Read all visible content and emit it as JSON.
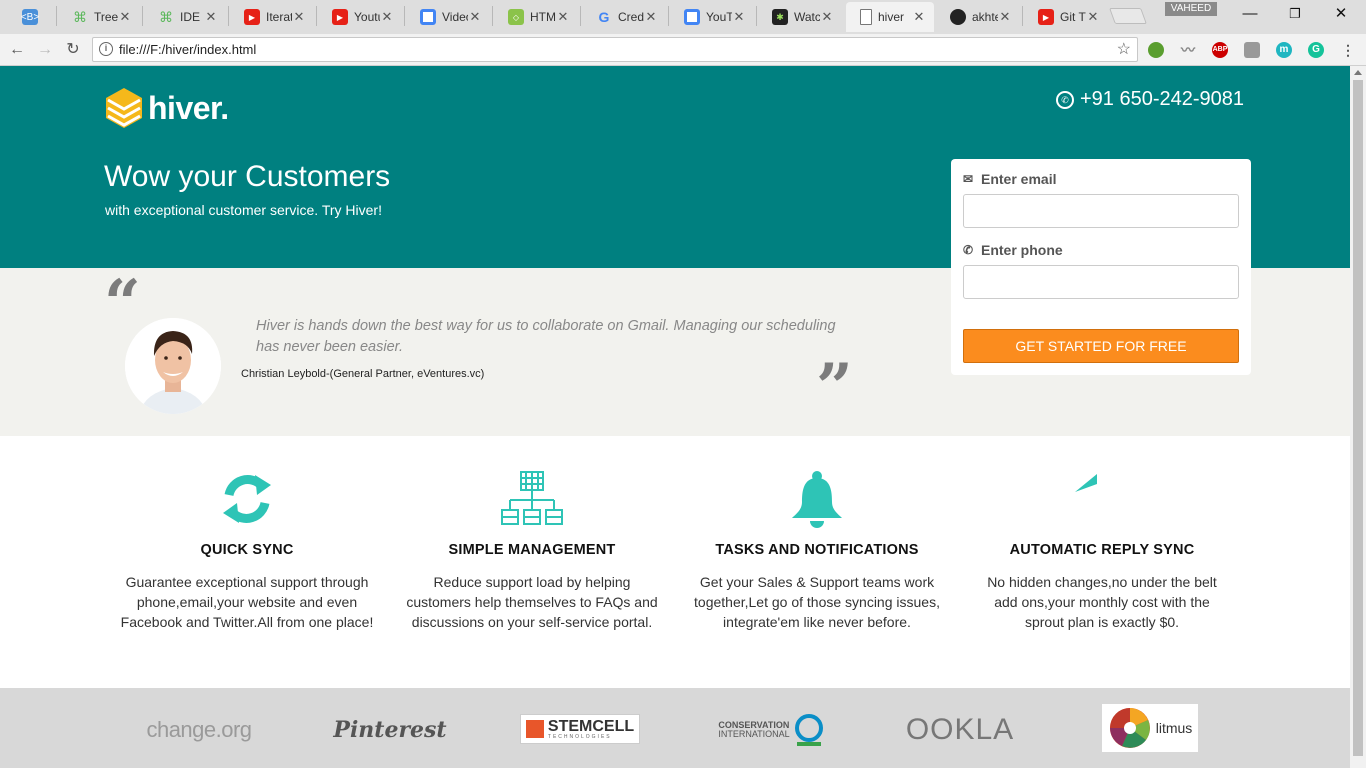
{
  "browser": {
    "tabs": [
      {
        "title": "",
        "fav": "bootstrap-icon",
        "color": "#4a90d9"
      },
      {
        "title": "Tree",
        "fav": "treehouse-icon",
        "color": "#5cb85c"
      },
      {
        "title": "IDE |",
        "fav": "treehouse-icon",
        "color": "#5cb85c"
      },
      {
        "title": "Iterat",
        "fav": "youtube-icon",
        "color": "#e62117"
      },
      {
        "title": "Youtu",
        "fav": "youtube-icon",
        "color": "#e62117"
      },
      {
        "title": "Video",
        "fav": "chrome-icon",
        "color": "#4285f4"
      },
      {
        "title": "HTM",
        "fav": "html-icon",
        "color": "#8bc34a"
      },
      {
        "title": "Cred",
        "fav": "google-icon",
        "color": "#4285f4"
      },
      {
        "title": "YouT",
        "fav": "chrome-icon",
        "color": "#4285f4"
      },
      {
        "title": "Watc",
        "fav": "watch-icon",
        "color": "#333333"
      },
      {
        "title": "hiver",
        "fav": "file-icon",
        "color": "#ffffff"
      },
      {
        "title": "akhte",
        "fav": "github-icon",
        "color": "#222222"
      },
      {
        "title": "Git T",
        "fav": "youtube-icon",
        "color": "#e62117"
      }
    ],
    "profile_name": "VAHEED",
    "url": "file:///F:/hiver/index.html"
  },
  "header": {
    "logo_text": "hiver.",
    "phone": "+91 650-242-9081",
    "title": "Wow your Customers",
    "subtitle": "with exceptional customer service. Try Hiver!"
  },
  "testimonial": {
    "quote": "Hiver is hands down the best way for us to collaborate on Gmail. Managing our scheduling has never been easier.",
    "author": "Christian Leybold-(General Partner, eVentures.vc)"
  },
  "signup": {
    "email_label": "Enter email",
    "phone_label": "Enter phone",
    "email_value": "",
    "phone_value": "",
    "button_label": "GET STARTED FOR FREE"
  },
  "features": [
    {
      "icon": "sync-icon",
      "title": "QUICK SYNC",
      "text": "Guarantee exceptional support through phone,email,your website and even Facebook and Twitter.All from one place!"
    },
    {
      "icon": "sitemap-icon",
      "title": "SIMPLE MANAGEMENT",
      "text": "Reduce support load by helping customers help themselves to FAQs and discussions on your self-service portal."
    },
    {
      "icon": "bell-icon",
      "title": "TASKS AND NOTIFICATIONS",
      "text": "Get your Sales & Support teams work together,Let go of those syncing issues, integrate'em like never before."
    },
    {
      "icon": "reply-icon",
      "title": "AUTOMATIC REPLY SYNC",
      "text": "No hidden changes,no under the belt add ons,your monthly cost with the sprout plan is exactly $0."
    }
  ],
  "clients": [
    {
      "name": "change.org"
    },
    {
      "name": "Pinterest"
    },
    {
      "name": "STEMCELL",
      "sub": "TECHNOLOGIES"
    },
    {
      "name": "CONSERVATION",
      "sub": "INTERNATIONAL"
    },
    {
      "name": "OOKLA"
    },
    {
      "name": "litmus"
    }
  ],
  "colors": {
    "brand_teal": "#008080",
    "accent_orange": "#fb8c1e",
    "icon_teal": "#2ec4b6",
    "logo_yellow": "#f5b81b"
  }
}
